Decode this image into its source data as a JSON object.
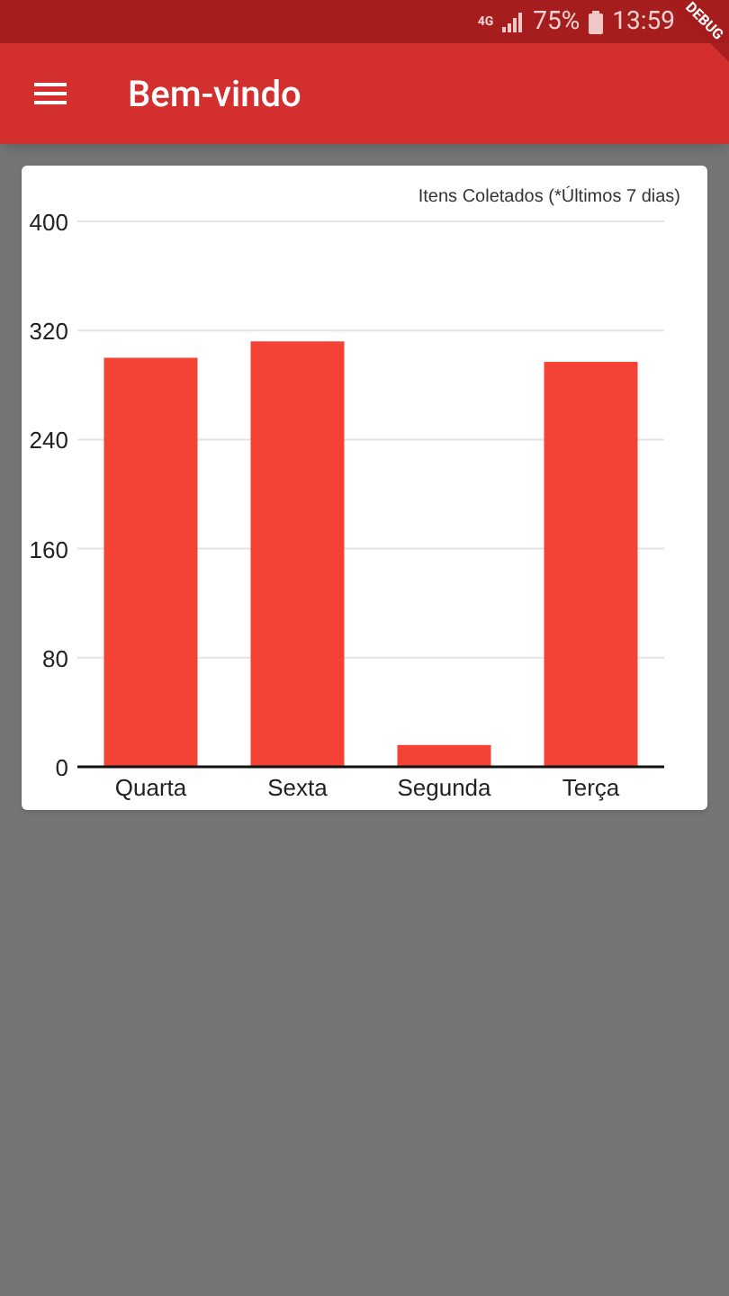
{
  "status_bar": {
    "network": "4G",
    "battery": "75%",
    "time": "13:59"
  },
  "debug_banner": "DEBUG",
  "app_bar": {
    "title": "Bem-vindo"
  },
  "chart_data": {
    "type": "bar",
    "title": "Itens Coletados (*Últimos 7 dias)",
    "categories": [
      "Quarta",
      "Sexta",
      "Segunda",
      "Terça"
    ],
    "series": [
      {
        "color": "#f44336",
        "values": [
          300,
          312,
          16,
          297
        ]
      }
    ],
    "ylim": [
      0,
      400
    ],
    "yticks": [
      0,
      80,
      160,
      240,
      320,
      400
    ],
    "grid": true
  }
}
